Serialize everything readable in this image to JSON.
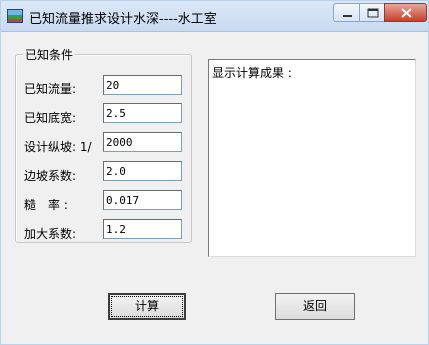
{
  "window": {
    "title": "已知流量推求设计水深----水工室"
  },
  "known_conditions": {
    "group_title": "已知条件",
    "fields": [
      {
        "label": "已知流量:",
        "value": "20"
      },
      {
        "label": "已知底宽:",
        "value": "2.5"
      },
      {
        "label": "设计纵坡: 1/",
        "value": "2000"
      },
      {
        "label": "边坡系数:",
        "value": "2.0"
      },
      {
        "label": "糙　率 :",
        "value": "0.017"
      },
      {
        "label": "加大系数:",
        "value": "1.2"
      }
    ]
  },
  "output": {
    "text": "显示计算成果 :"
  },
  "buttons": {
    "calculate": "计算",
    "back": "返回"
  },
  "icons": {
    "app": "app-icon",
    "minimize": "minimize-icon",
    "maximize": "maximize-icon",
    "close": "close-icon"
  }
}
